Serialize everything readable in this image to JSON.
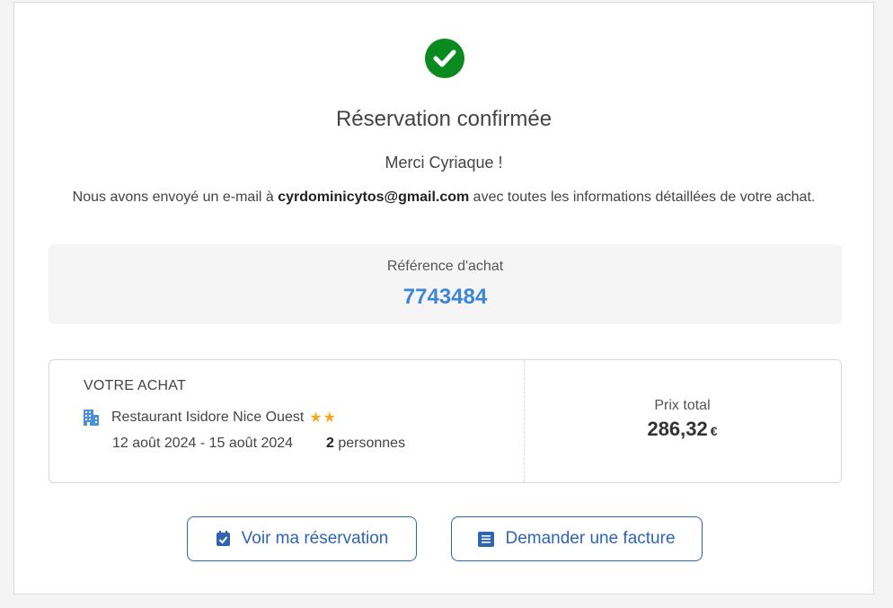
{
  "confirmation": {
    "title": "Réservation confirmée",
    "thanks": "Merci Cyriaque !",
    "email_prefix": "Nous avons envoyé un e-mail à ",
    "email": "cyrdominicytos@gmail.com",
    "email_suffix": " avec toutes les informations détaillées de votre achat."
  },
  "reference": {
    "label": "Référence d'achat",
    "value": "7743484"
  },
  "purchase": {
    "heading": "VOTRE ACHAT",
    "hotel_name": "Restaurant Isidore Nice Ouest",
    "stars": "★★",
    "dates": "12 août 2024 - 15 août 2024",
    "people_count": "2",
    "people_label": " personnes",
    "total_label": "Prix total",
    "total_value": "286,32",
    "currency": "€"
  },
  "actions": {
    "view_label": "Voir ma réservation",
    "invoice_label": "Demander une facture"
  },
  "colors": {
    "success": "#0b8a1f",
    "accent": "#3d86d6",
    "button": "#2f65b0",
    "star": "#f5a623"
  },
  "icons": {
    "check": "check-circle-icon",
    "building": "building-icon",
    "view": "calendar-check-icon",
    "invoice": "invoice-list-icon"
  }
}
